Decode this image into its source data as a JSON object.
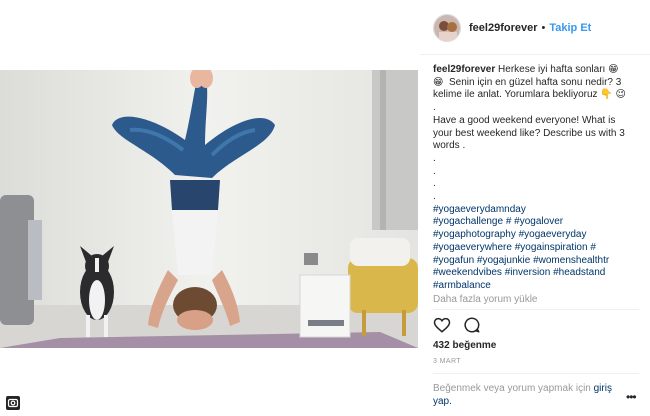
{
  "post": {
    "username": "feel29forever",
    "separator": "•",
    "follow_label": "Takip Et",
    "caption_user": "feel29forever",
    "caption_lines": [
      " Herkese iyi hafta sonları 😁",
      "😁  Senin için en güzel hafta sonu nedir? 3",
      "kelime ile anlat. Yorumlara bekliyoruz 👇 😉",
      ".",
      "Have a good weekend everyone! What is",
      "your best weekend like? Describe us with 3",
      "words .",
      ".",
      ".",
      ".",
      "."
    ],
    "hashtag_lines": [
      "#yogaeverydamnday",
      "#yogachallenge # #yogalover",
      "#yogaphotography #yogaeveryday",
      "#yogaeverywhere #yogainspiration #",
      "#yogafun #yogajunkie #womenshealthtr",
      "#weekendvibes #inversion #headstand",
      "#armbalance"
    ],
    "load_more": "Daha fazla yorum yükle",
    "likes": "432 beğenme",
    "date": "3 MART",
    "login_prefix": "Beğenmek veya yorum yapmak için ",
    "login_link": "giriş",
    "login_suffix": "yap.",
    "more_options": "•••"
  },
  "icons": {
    "like": "heart-icon",
    "comment": "comment-icon",
    "options": "more-options-icon",
    "corner": "instagram-camera-icon"
  },
  "colors": {
    "link_blue": "#3897f0",
    "hashtag": "#003569",
    "muted": "#999999",
    "text": "#262626"
  }
}
